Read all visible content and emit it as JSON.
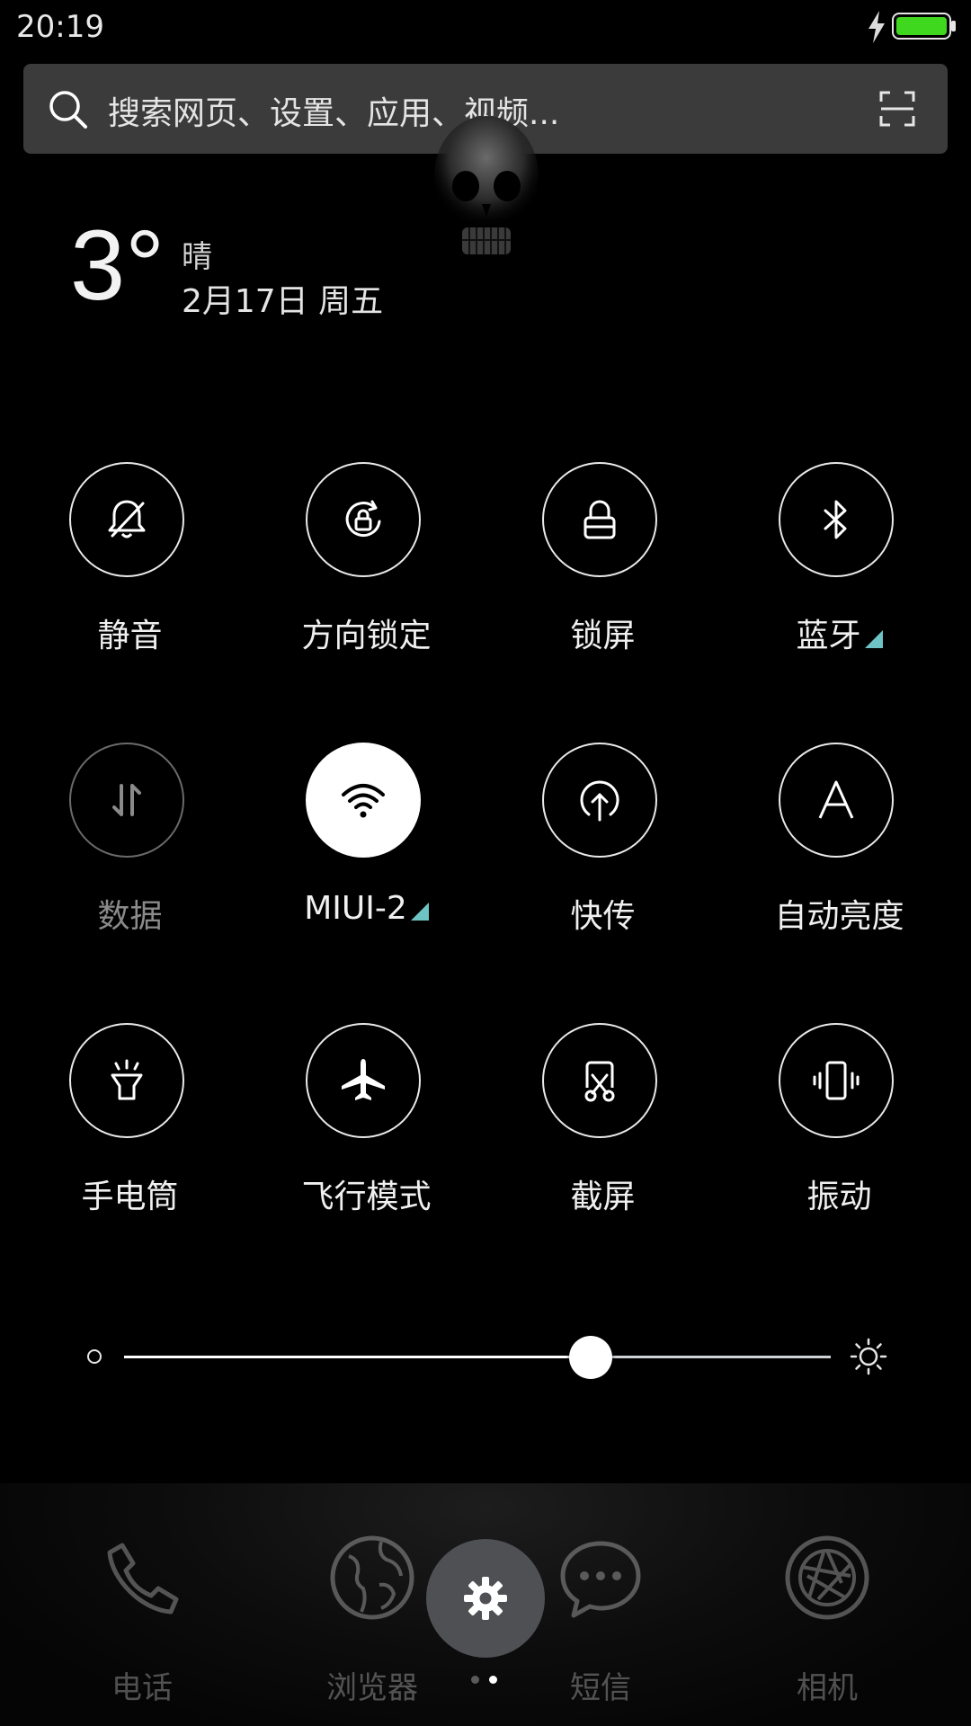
{
  "status_bar": {
    "time": "20:19",
    "battery_color": "#3fd81f"
  },
  "search": {
    "placeholder": "搜索网页、设置、应用、视频..."
  },
  "weather": {
    "temperature": "3°",
    "condition": "晴",
    "date": "2月17日 周五"
  },
  "toggles": [
    {
      "id": "silent",
      "label": "静音",
      "icon": "bell-off-icon",
      "state": "off"
    },
    {
      "id": "rotation",
      "label": "方向锁定",
      "icon": "rotation-lock-icon",
      "state": "off"
    },
    {
      "id": "lock",
      "label": "锁屏",
      "icon": "lock-icon",
      "state": "off"
    },
    {
      "id": "bluetooth",
      "label": "蓝牙",
      "icon": "bluetooth-icon",
      "state": "off",
      "has_more": true
    },
    {
      "id": "data",
      "label": "数据",
      "icon": "data-arrows-icon",
      "state": "disabled"
    },
    {
      "id": "wifi",
      "label": "MIUI-2",
      "icon": "wifi-icon",
      "state": "on",
      "has_more": true
    },
    {
      "id": "share",
      "label": "快传",
      "icon": "upload-icon",
      "state": "off"
    },
    {
      "id": "autobright",
      "label": "自动亮度",
      "icon": "auto-brightness-icon",
      "state": "off"
    },
    {
      "id": "flashlight",
      "label": "手电筒",
      "icon": "flashlight-icon",
      "state": "off"
    },
    {
      "id": "airplane",
      "label": "飞行模式",
      "icon": "airplane-icon",
      "state": "off"
    },
    {
      "id": "screenshot",
      "label": "截屏",
      "icon": "screenshot-icon",
      "state": "off"
    },
    {
      "id": "vibrate",
      "label": "振动",
      "icon": "vibrate-icon",
      "state": "off"
    }
  ],
  "brightness": {
    "level": 0.66
  },
  "dock": {
    "items": [
      {
        "label": "电话",
        "icon": "phone-icon"
      },
      {
        "label": "浏览器",
        "icon": "browser-icon"
      },
      {
        "label": "短信",
        "icon": "message-icon"
      },
      {
        "label": "相机",
        "icon": "camera-icon"
      }
    ],
    "accent_marker": "#6ec3c5"
  }
}
